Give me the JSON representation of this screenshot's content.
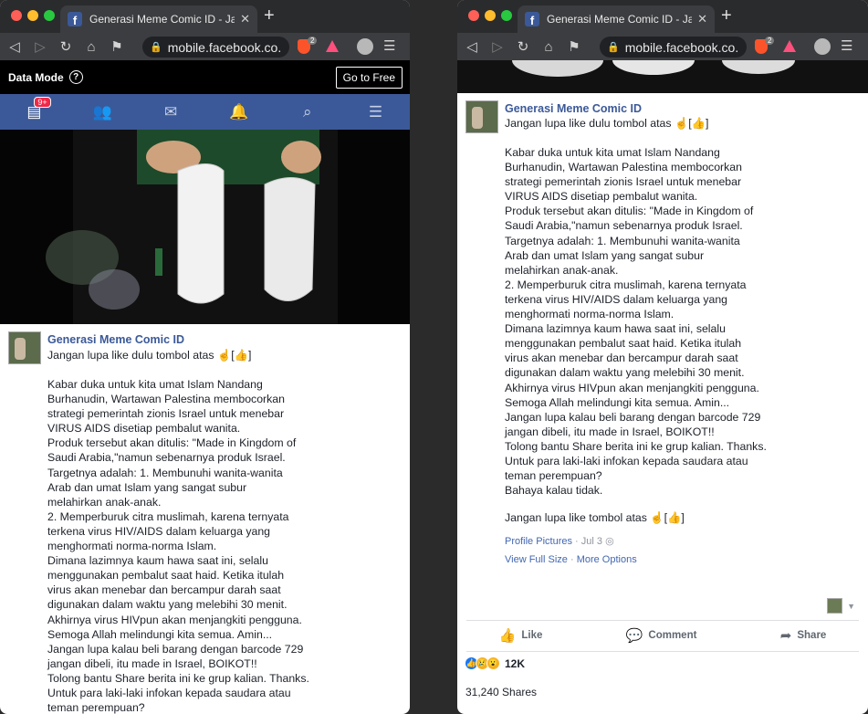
{
  "browser": {
    "tab_title": "Generasi Meme Comic ID - Jang",
    "url": "mobile.facebook.co...",
    "brave_badge": "2"
  },
  "data_mode": {
    "label": "Data Mode",
    "go_free": "Go to Free"
  },
  "fb_nav": {
    "notif_count": "9+"
  },
  "post": {
    "page_name": "Generasi Meme Comic ID",
    "first_line": "Jangan lupa like dulu tombol atas ☝[👍]",
    "body_left": "Kabar duka untuk kita umat Islam Nandang\nBurhanudin, Wartawan Palestina membocorkan\nstrategi pemerintah zionis Israel untuk menebar\nVIRUS AIDS disetiap pembalut wanita.\nProduk tersebut akan ditulis: \"Made in Kingdom of\nSaudi Arabia,\"namun sebenarnya produk Israel.\nTargetnya adalah: 1. Membunuhi wanita-wanita\nArab dan umat Islam yang sangat subur\nmelahirkan anak-anak.\n2. Memperburuk citra muslimah, karena ternyata\nterkena virus HIV/AIDS dalam keluarga yang\nmenghormati norma-norma Islam.\nDimana lazimnya kaum hawa saat ini, selalu\nmenggunakan pembalut saat haid. Ketika itulah\nvirus akan menebar dan bercampur darah saat\ndigunakan dalam waktu yang melebihi 30 menit.\nAkhirnya virus HIVpun akan menjangkiti pengguna.\nSemoga Allah melindungi kita semua. Amin...\nJangan lupa kalau beli barang dengan barcode 729\njangan dibeli, itu made in Israel, BOIKOT!!\nTolong bantu Share berita ini ke grup kalian. Thanks.\nUntuk para laki-laki infokan kepada saudara atau\nteman perempuan?",
    "body_right": "Kabar duka untuk kita umat Islam Nandang\nBurhanudin, Wartawan Palestina membocorkan\nstrategi pemerintah zionis Israel untuk menebar\nVIRUS AIDS disetiap pembalut wanita.\nProduk tersebut akan ditulis: \"Made in Kingdom of\nSaudi Arabia,\"namun sebenarnya produk Israel.\nTargetnya adalah: 1. Membunuhi wanita-wanita\nArab dan umat Islam yang sangat subur\nmelahirkan anak-anak.\n2. Memperburuk citra muslimah, karena ternyata\nterkena virus HIV/AIDS dalam keluarga yang\nmenghormati norma-norma Islam.\nDimana lazimnya kaum hawa saat ini, selalu\nmenggunakan pembalut saat haid. Ketika itulah\nvirus akan menebar dan bercampur darah saat\ndigunakan dalam waktu yang melebihi 30 menit.\nAkhirnya virus HIVpun akan menjangkiti pengguna.\nSemoga Allah melindungi kita semua. Amin...\nJangan lupa kalau beli barang dengan barcode 729\njangan dibeli, itu made in Israel, BOIKOT!!\nTolong bantu Share berita ini ke grup kalian. Thanks.\nUntuk para laki-laki infokan kepada saudara atau\nteman perempuan?\nBahaya kalau tidak.",
    "last_line": "Jangan lupa like tombol atas ☝[👍]",
    "album": "Profile Pictures",
    "date": "Jul 3",
    "view_full_size": "View Full Size",
    "more_options": "More Options",
    "like_label": "Like",
    "comment_label": "Comment",
    "share_label": "Share",
    "reaction_count": "12K",
    "shares_count": "31,240 Shares"
  },
  "colors": {
    "fb_blue": "#3b5998",
    "link_blue": "#4267b2"
  }
}
